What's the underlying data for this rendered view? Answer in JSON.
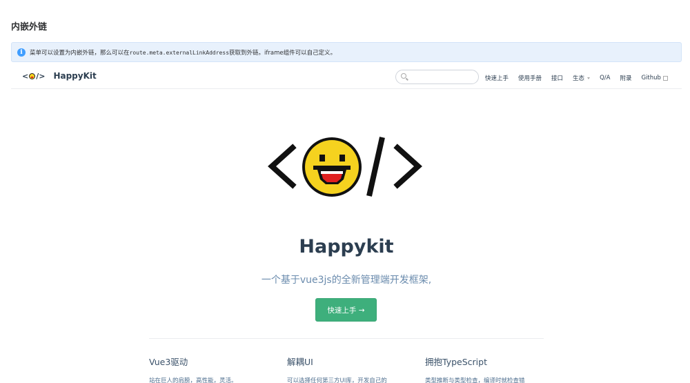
{
  "page": {
    "title": "内嵌外链"
  },
  "notice": {
    "icon": "info-icon",
    "text_before": "菜单可以设置为内嵌外链，那么可以在",
    "code": "route.meta.externalLinkAddress",
    "text_after": "获取到外链。iframe组件可以自己定义。"
  },
  "site": {
    "logo_text_left": "<",
    "logo_text_right": "/>",
    "brand_name": "HappyKit",
    "search": {
      "value": "",
      "placeholder": ""
    },
    "nav": [
      {
        "label": "快速上手"
      },
      {
        "label": "使用手册"
      },
      {
        "label": "接口"
      },
      {
        "label": "生态"
      },
      {
        "label": "Q/A"
      },
      {
        "label": "附录"
      },
      {
        "label": "Github"
      }
    ],
    "hero": {
      "title": "Happykit",
      "description": "一个基于vue3js的全新管理端开发框架,",
      "action_label": "快速上手 →"
    },
    "features": [
      {
        "title": "Vue3驱动",
        "details": "站在巨人的肩膀，高性能，灵活。"
      },
      {
        "title": "解耦UI",
        "details": "可以选择任何第三方UI库，开发自己的"
      },
      {
        "title": "拥抱TypeScript",
        "details": "类型推断与类型检查，编译时就检查错"
      }
    ]
  },
  "colors": {
    "accent": "#3eaf7c",
    "info": "#409eff",
    "notice_bg": "#e8f1fc",
    "face_yellow": "#f5d21f",
    "mouth_red": "#e02020"
  }
}
